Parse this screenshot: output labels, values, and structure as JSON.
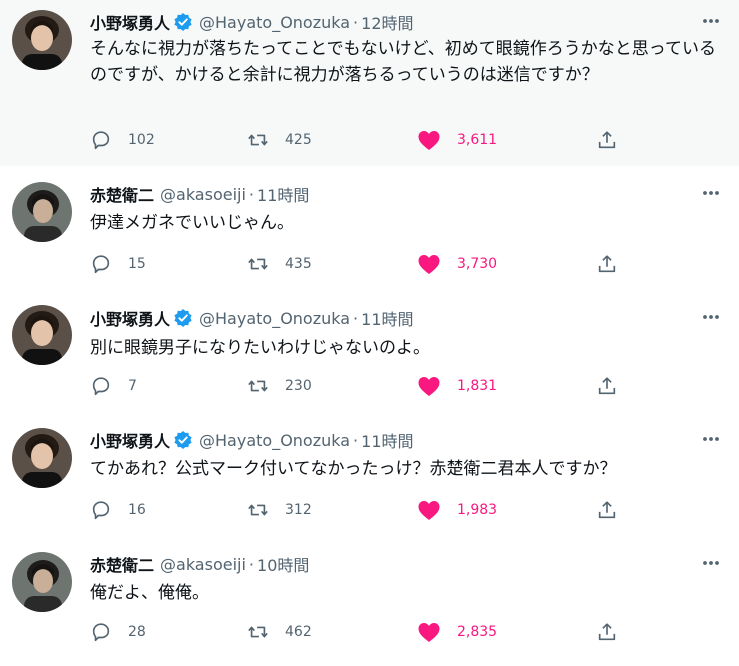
{
  "colors": {
    "like_pink": "#f91880",
    "verified_blue": "#1d9bf0",
    "secondary_text": "#536471",
    "highlight_bg": "#f7f9f9"
  },
  "icons": {
    "reply": "speech-bubble-icon",
    "retweet": "retweet-arrows-icon",
    "like": "filled-heart-icon",
    "share": "share-upload-icon",
    "more": "three-dots-icon",
    "verified": "verified-badge-icon"
  },
  "tweets": [
    {
      "name": "小野塚勇人",
      "verified": true,
      "handle": "@Hayato_Onozuka",
      "dot": "·",
      "time": "12時間",
      "text": "そんなに視力が落ちたってことでもないけど、初めて眼鏡作ろうかなと思っているのですが、かけると余計に視力が落ちるっていうのは迷信ですか？",
      "replies": "102",
      "retweets": "425",
      "likes": "3,611",
      "highlighted": true
    },
    {
      "name": "赤楚衛二",
      "verified": false,
      "handle": "@akasoeiji",
      "dot": "·",
      "time": "11時間",
      "text": "伊達メガネでいいじゃん。",
      "replies": "15",
      "retweets": "435",
      "likes": "3,730",
      "highlighted": false
    },
    {
      "name": "小野塚勇人",
      "verified": true,
      "handle": "@Hayato_Onozuka",
      "dot": "·",
      "time": "11時間",
      "text": "別に眼鏡男子になりたいわけじゃないのよ。",
      "replies": "7",
      "retweets": "230",
      "likes": "1,831",
      "highlighted": false
    },
    {
      "name": "小野塚勇人",
      "verified": true,
      "handle": "@Hayato_Onozuka",
      "dot": "·",
      "time": "11時間",
      "text": "てかあれ？公式マーク付いてなかったっけ？赤楚衛二君本人ですか？",
      "replies": "16",
      "retweets": "312",
      "likes": "1,983",
      "highlighted": false
    },
    {
      "name": "赤楚衛二",
      "verified": false,
      "handle": "@akasoeiji",
      "dot": "·",
      "time": "10時間",
      "text": "俺だよ、俺俺。",
      "replies": "28",
      "retweets": "462",
      "likes": "2,835",
      "highlighted": false
    }
  ]
}
